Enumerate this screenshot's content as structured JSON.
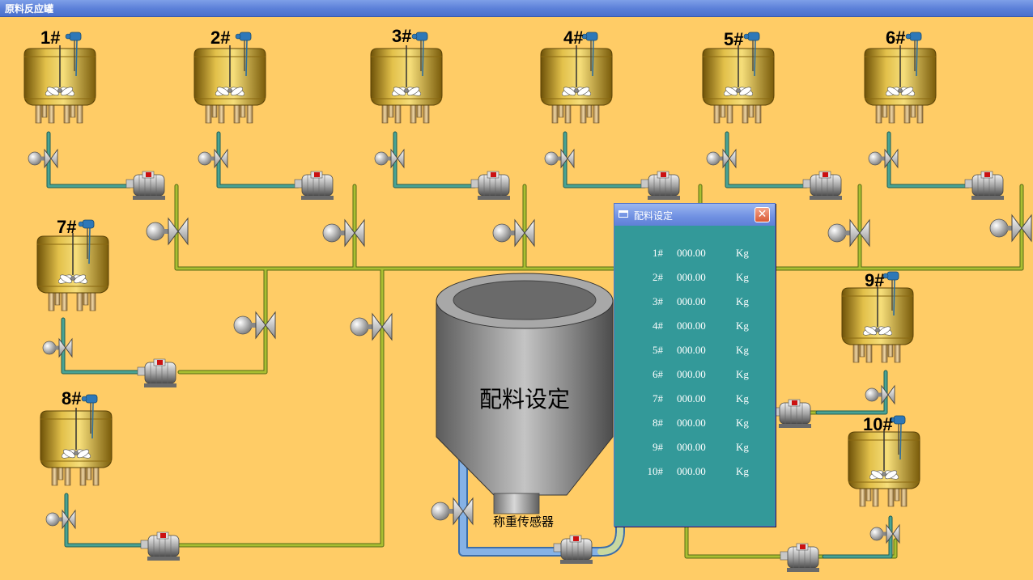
{
  "window": {
    "title": "原料反应罐"
  },
  "tanks": [
    "1#",
    "2#",
    "3#",
    "4#",
    "5#",
    "6#",
    "7#",
    "8#",
    "9#",
    "10#"
  ],
  "hopper": {
    "label": "配料设定",
    "sensor_label": "称重传感器"
  },
  "dialog": {
    "title": "配料设定",
    "close_glyph": "✕",
    "rows": [
      {
        "tank": "1#",
        "value": "000.00",
        "unit": "Kg"
      },
      {
        "tank": "2#",
        "value": "000.00",
        "unit": "Kg"
      },
      {
        "tank": "3#",
        "value": "000.00",
        "unit": "Kg"
      },
      {
        "tank": "4#",
        "value": "000.00",
        "unit": "Kg"
      },
      {
        "tank": "5#",
        "value": "000.00",
        "unit": "Kg"
      },
      {
        "tank": "6#",
        "value": "000.00",
        "unit": "Kg"
      },
      {
        "tank": "7#",
        "value": "000.00",
        "unit": "Kg"
      },
      {
        "tank": "8#",
        "value": "000.00",
        "unit": "Kg"
      },
      {
        "tank": "9#",
        "value": "000.00",
        "unit": "Kg"
      },
      {
        "tank": "10#",
        "value": "000.00",
        "unit": "Kg"
      }
    ]
  },
  "colors": {
    "background": "#FFCC66",
    "pipe_green": "#8A9A1C",
    "pipe_teal": "#2E7F73",
    "pipe_blue": "#6F9FD8",
    "tank_gold": "#C9A022",
    "dialog_bg": "#339999",
    "pump_red": "#CC1111"
  }
}
